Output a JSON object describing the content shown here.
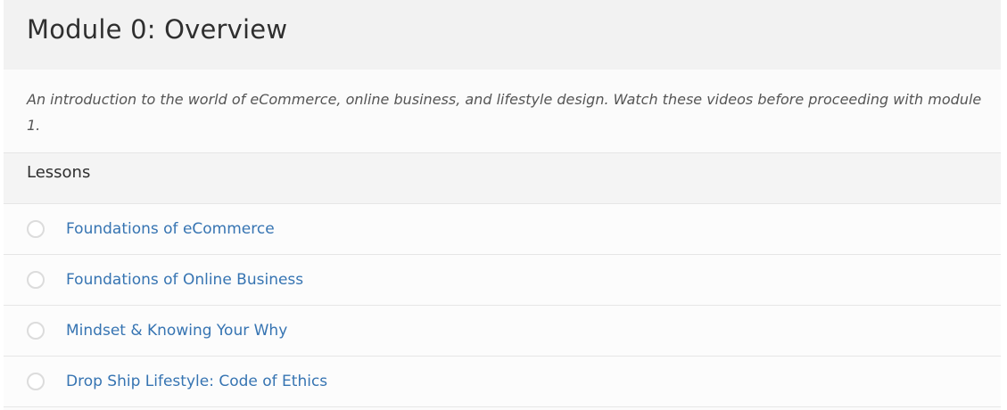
{
  "module": {
    "title": "Module 0: Overview",
    "description": "An introduction to the world of eCommerce, online business, and lifestyle design. Watch these videos before proceeding with module 1.",
    "lessons_heading": "Lessons",
    "lessons": [
      {
        "title": "Foundations of eCommerce",
        "status_icon": "empty-circle-icon",
        "completed": false
      },
      {
        "title": "Foundations of Online Business",
        "status_icon": "empty-circle-icon",
        "completed": false
      },
      {
        "title": "Mindset & Knowing Your Why",
        "status_icon": "empty-circle-icon",
        "completed": false
      },
      {
        "title": "Drop Ship Lifestyle: Code of Ethics",
        "status_icon": "empty-circle-icon",
        "completed": false
      }
    ]
  },
  "colors": {
    "header_bg": "#f2f2f2",
    "link": "#3674b2",
    "text": "#2f2f2f",
    "circle_border": "#dcdcdc"
  }
}
